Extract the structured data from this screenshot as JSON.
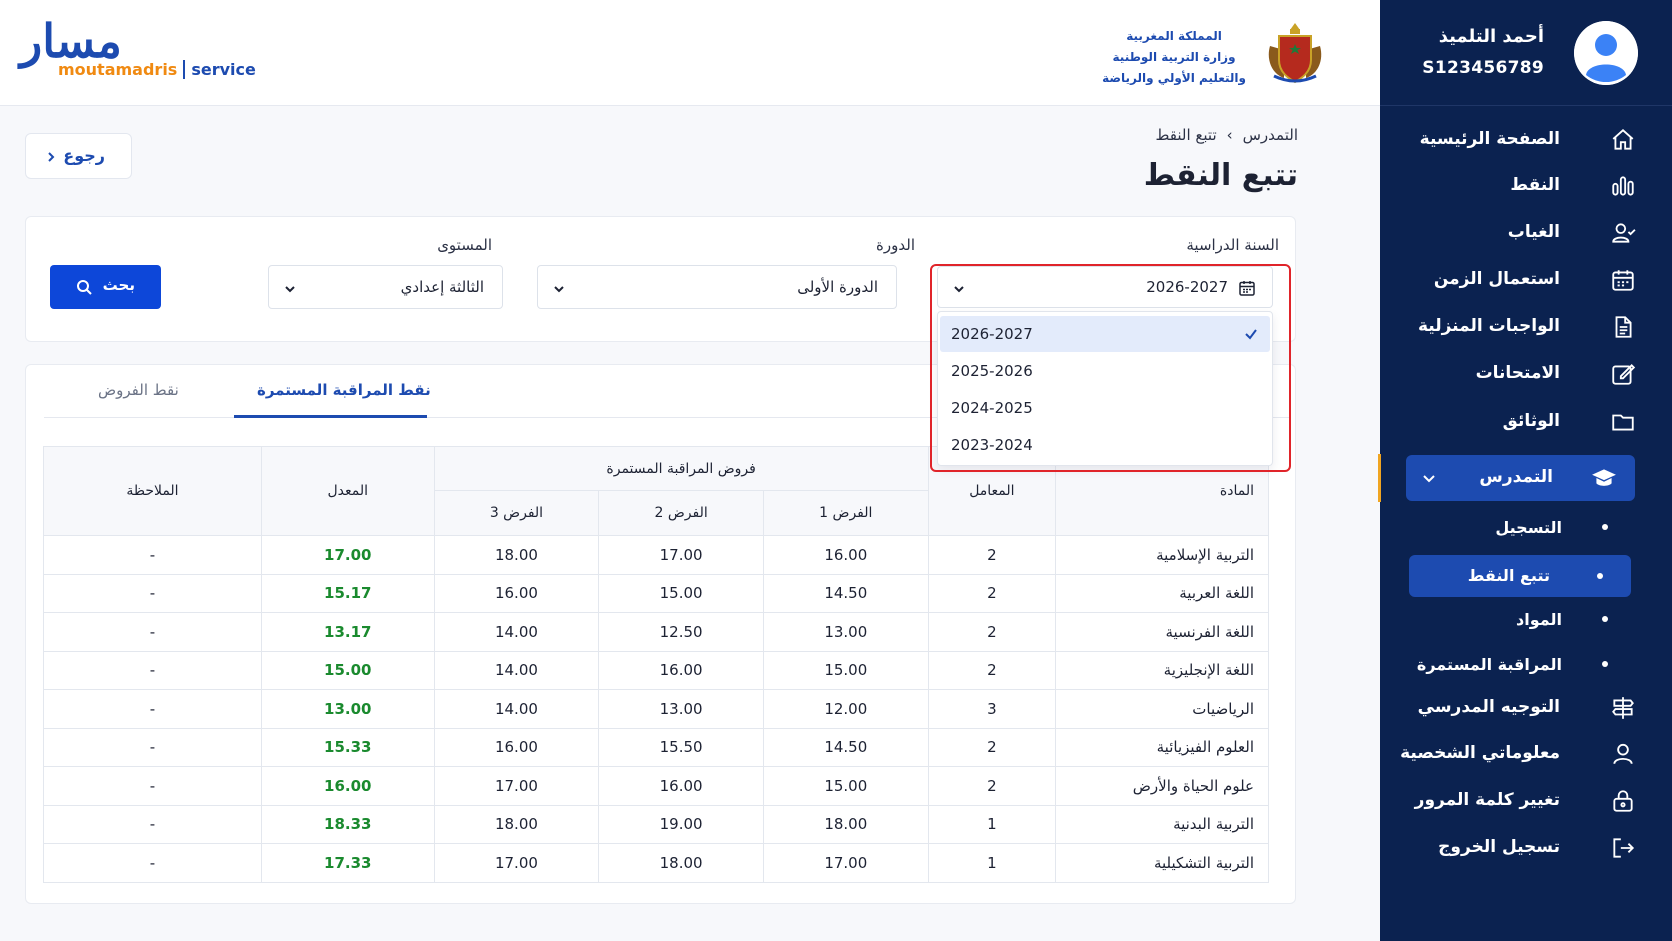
{
  "header": {
    "logo_arabic": "مسار",
    "logo_latin": "moutamadris",
    "logo_service": "service",
    "ministry_lines": [
      "المملكة المغربية",
      "وزارة التربية الوطنية",
      "والتعليم الأولي والرياضة"
    ],
    "emblem_icon": "kingdom-emblem-icon"
  },
  "profile": {
    "name": "أحمد التلميذ",
    "id": "S123456789",
    "avatar_icon": "user-avatar-icon"
  },
  "nav": {
    "items": [
      {
        "label": "الصفحة الرئيسية",
        "icon": "home-icon"
      },
      {
        "label": "النقط",
        "icon": "bar-chart-icon"
      },
      {
        "label": "الغياب",
        "icon": "user-check-icon"
      },
      {
        "label": "استعمال الزمن",
        "icon": "calendar-icon"
      },
      {
        "label": "الواجبات المنزلية",
        "icon": "document-icon"
      },
      {
        "label": "الامتحانات",
        "icon": "edit-icon"
      },
      {
        "label": "الوثائق",
        "icon": "folder-icon"
      }
    ],
    "active_group": {
      "label": "التمدرس",
      "icon": "graduation-cap-icon"
    },
    "sub_items": [
      {
        "label": "التسجيل"
      },
      {
        "label": "تتبع النقط"
      },
      {
        "label": "المواد"
      },
      {
        "label": "المراقبة المستمرة"
      }
    ],
    "bottom_items": [
      {
        "label": "التوجيه المدرسي",
        "icon": "signpost-icon"
      },
      {
        "label": "معلوماتي الشخصية",
        "icon": "user-icon"
      },
      {
        "label": "تغيير كلمة المرور",
        "icon": "lock-icon"
      },
      {
        "label": "تسجيل الخروج",
        "icon": "logout-icon"
      }
    ]
  },
  "breadcrumb": {
    "parent": "التمدرس",
    "current": "تتبع النقط"
  },
  "page_title": "تتبع النقط",
  "back_label": "رجوع",
  "filters": {
    "year_label": "السنة الدراسية",
    "year_value": "2026-2027",
    "year_options": [
      "2026-2027",
      "2025-2026",
      "2024-2025",
      "2023-2024"
    ],
    "session_label": "الدورة",
    "session_value": "الدورة الأولى",
    "level_label": "المستوى",
    "level_value": "الثالثة إعدادي",
    "search_label": "بحث"
  },
  "tabs": {
    "active": "نقط المراقبة المستمرة",
    "inactive": "نقط الفروض"
  },
  "table": {
    "headers": {
      "subject": "المادة",
      "coef": "المعامل",
      "group": "فروض المراقبة المستمرة",
      "t1": "الفرض 1",
      "t2": "الفرض 2",
      "t3": "الفرض 3",
      "avg": "المعدل",
      "note": "الملاحظة"
    },
    "rows": [
      {
        "subject": "التربية الإسلامية",
        "coef": "2",
        "t1": "16.00",
        "t2": "17.00",
        "t3": "18.00",
        "avg": "17.00",
        "note": "-"
      },
      {
        "subject": "اللغة العربية",
        "coef": "2",
        "t1": "14.50",
        "t2": "15.00",
        "t3": "16.00",
        "avg": "15.17",
        "note": "-"
      },
      {
        "subject": "اللغة الفرنسية",
        "coef": "2",
        "t1": "13.00",
        "t2": "12.50",
        "t3": "14.00",
        "avg": "13.17",
        "note": "-"
      },
      {
        "subject": "اللغة الإنجليزية",
        "coef": "2",
        "t1": "15.00",
        "t2": "16.00",
        "t3": "14.00",
        "avg": "15.00",
        "note": "-"
      },
      {
        "subject": "الرياضيات",
        "coef": "3",
        "t1": "12.00",
        "t2": "13.00",
        "t3": "14.00",
        "avg": "13.00",
        "note": "-"
      },
      {
        "subject": "العلوم الفيزيائية",
        "coef": "2",
        "t1": "14.50",
        "t2": "15.50",
        "t3": "16.00",
        "avg": "15.33",
        "note": "-"
      },
      {
        "subject": "علوم الحياة والأرض",
        "coef": "2",
        "t1": "15.00",
        "t2": "16.00",
        "t3": "17.00",
        "avg": "16.00",
        "note": "-"
      },
      {
        "subject": "التربية البدنية",
        "coef": "1",
        "t1": "18.00",
        "t2": "19.00",
        "t3": "18.00",
        "avg": "18.33",
        "note": "-"
      },
      {
        "subject": "التربية التشكيلية",
        "coef": "1",
        "t1": "17.00",
        "t2": "18.00",
        "t3": "17.00",
        "avg": "17.33",
        "note": "-"
      }
    ]
  },
  "colors": {
    "sidebar_bg": "#0b2250",
    "accent_blue": "#1d4bb0",
    "button_blue": "#0d47d9",
    "avg_green": "#1a8a2e",
    "highlight_red": "#e0242a",
    "logo_orange": "#f08a12"
  }
}
